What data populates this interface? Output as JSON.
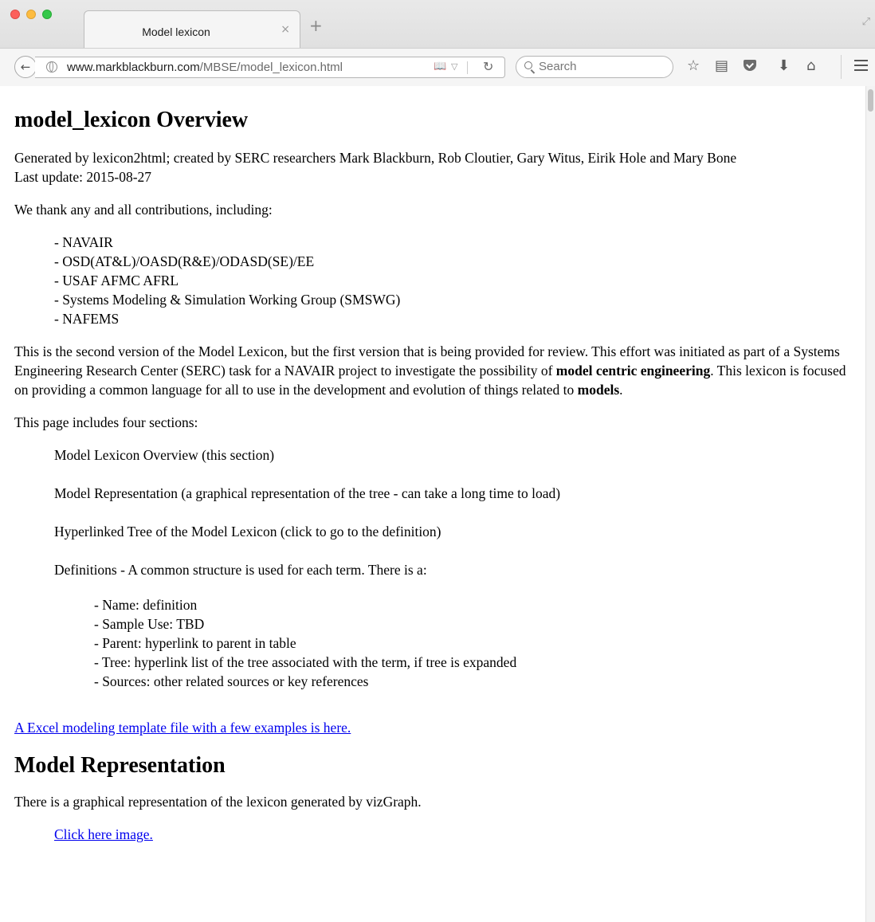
{
  "window": {
    "tab_title": "Model lexicon",
    "tab_close_glyph": "×",
    "new_tab_glyph": "+"
  },
  "navbar": {
    "url_domain": "www.markblackburn.com",
    "url_path": "/MBSE/model_lexicon.html",
    "search_placeholder": "Search"
  },
  "page": {
    "title": "model_lexicon Overview",
    "credits": "Generated by lexicon2html; created by SERC researchers Mark Blackburn, Rob Cloutier, Gary Witus, Eirik Hole and Mary Bone",
    "last_update": "Last update: 2015-08-27",
    "thanks": "We thank any and all contributions, including:",
    "contributors": [
      "- NAVAIR",
      "- OSD(AT&L)/OASD(R&E)/ODASD(SE)/EE",
      "- USAF AFMC AFRL",
      "- Systems Modeling & Simulation Working Group (SMSWG)",
      "- NAFEMS"
    ],
    "intro_part1": "This is the second version of the Model Lexicon, but the first version that is being provided for review. This effort was initiated as part of a Systems Engineering Research Center (SERC) task for a NAVAIR project to investigate the possibility of ",
    "intro_bold1": "model centric engineering",
    "intro_part2": ". This lexicon is focused on providing a common language for all to use in the development and evolution of things related to ",
    "intro_bold2": "models",
    "intro_part3": ".",
    "sections_intro": "This page includes four sections:",
    "sections": [
      "Model Lexicon Overview (this section)",
      "Model Representation (a graphical representation of the tree - can take a long time to load)",
      "Hyperlinked Tree of the Model Lexicon (click to go to the definition)",
      "Definitions - A common structure is used for each term. There is a:"
    ],
    "definition_structure": [
      "- Name: definition",
      "- Sample Use: TBD",
      "- Parent: hyperlink to parent in table",
      "- Tree: hyperlink list of the tree associated with the term, if tree is expanded",
      "- Sources: other related sources or key references"
    ],
    "excel_link": "A Excel modeling template file with a few examples is here.",
    "section2_heading": "Model Representation",
    "section2_text": "There is a graphical representation of the lexicon generated by vizGraph.",
    "image_link": "Click here image."
  }
}
